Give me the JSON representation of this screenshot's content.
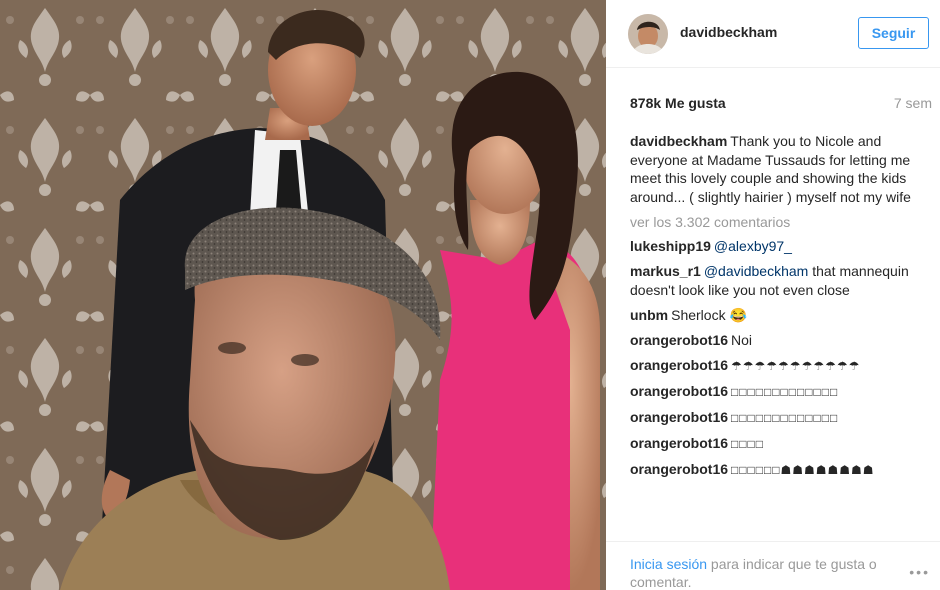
{
  "post": {
    "username": "davidbeckham",
    "follow_label": "Seguir",
    "likes": "878k Me gusta",
    "time": "7 sem",
    "caption": {
      "username": "davidbeckham",
      "text": "Thank you to Nicole and everyone at Madame Tussauds for letting me meet this lovely couple and showing the kids around... ( slightly hairier ) myself not my wife"
    },
    "view_more": "ver los 3.302 comentarios",
    "comments": [
      {
        "username": "lukeshipp19",
        "mention": "@alexby97_",
        "text": ""
      },
      {
        "username": "markus_r1",
        "mention": "@davidbeckham",
        "text": " that mannequin doesn't look like you not even close"
      },
      {
        "username": "unbm",
        "mention": "",
        "text": "Sherlock 😂"
      },
      {
        "username": "orangerobot16",
        "mention": "",
        "text": "Noi"
      },
      {
        "username": "orangerobot16",
        "mention": "",
        "text": "☂☂☂☂☂☂☂☂☂☂☂"
      },
      {
        "username": "orangerobot16",
        "mention": "",
        "text": "□□□□□□□□□□□□□"
      },
      {
        "username": "orangerobot16",
        "mention": "",
        "text": "□□□□□□□□□□□□□"
      },
      {
        "username": "orangerobot16",
        "mention": "",
        "text": "□□□□"
      },
      {
        "username": "orangerobot16",
        "mention": "",
        "text": "□□□□□□☗☗☗☗☗☗☗☗"
      }
    ],
    "footer": {
      "login_link": "Inicia sesión",
      "login_rest": " para indicar que te gusta o comentar.",
      "more_icon": "•••"
    }
  },
  "colors": {
    "accent": "#3897f0",
    "text": "#262626",
    "muted": "#999999",
    "dress": "#e8307a",
    "wallpaper": "#8a7663"
  }
}
